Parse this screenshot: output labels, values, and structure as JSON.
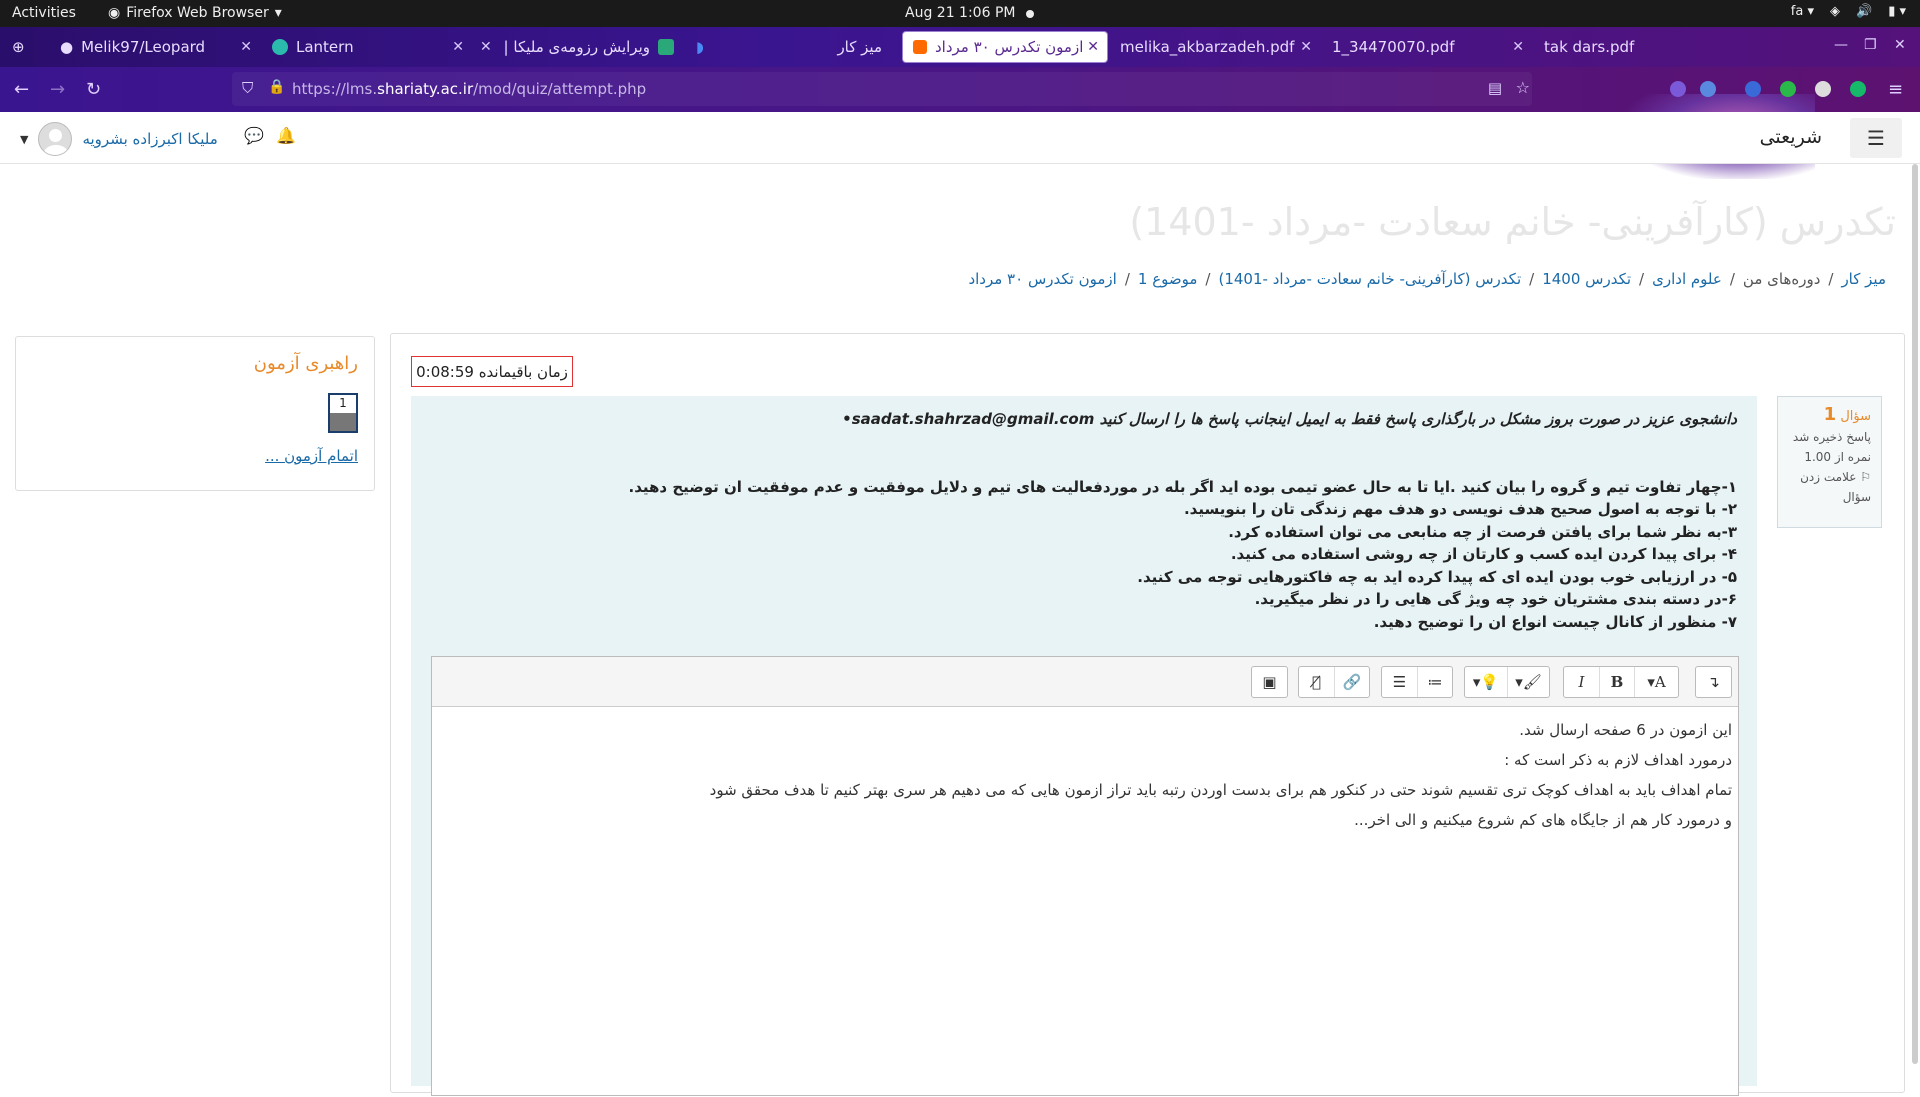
{
  "system": {
    "activities": "Activities",
    "app_name": "Firefox Web Browser",
    "clock": "Aug 21  1:06 PM",
    "lang": "fa"
  },
  "tabs": [
    {
      "label": "Melik97/Leopard",
      "active": false
    },
    {
      "label": "Lantern",
      "active": false
    },
    {
      "label": "ویرایش رزومه‌ی ملیکا |",
      "active": false
    },
    {
      "label": "میز کار",
      "active": false
    },
    {
      "label": "ازمون تکدرس ۳۰ مرداد",
      "active": true
    },
    {
      "label": "melika_akbarzadeh.pdf",
      "active": false
    },
    {
      "label": "1_34470070.pdf",
      "active": false
    },
    {
      "label": "tak dars.pdf",
      "active": false
    }
  ],
  "nav": {
    "url_prefix": "https://lms.",
    "url_host": "shariaty.ac.ir",
    "url_path": "/mod/quiz/attempt.php"
  },
  "header": {
    "site_name": "شریعتی",
    "user_name": "ملیکا اکبرزاده بشرویه"
  },
  "page": {
    "title": "تکدرس (کارآفرینی- خانم سعادت -مرداد -1401)",
    "breadcrumb": [
      {
        "label": "میز کار",
        "link": true
      },
      {
        "label": "دوره‌های من",
        "link": false
      },
      {
        "label": "علوم اداری",
        "link": true
      },
      {
        "label": "تکدرس 1400",
        "link": true
      },
      {
        "label": "تکدرس (کارآفرینی- خانم سعادت -مرداد -1401)",
        "link": true
      },
      {
        "label": "موضوع 1",
        "link": true
      },
      {
        "label": "ازمون تکدرس ۳۰ مرداد",
        "link": true
      }
    ]
  },
  "quiz_nav": {
    "title": "راهبری آزمون",
    "question_number": "1",
    "finish_link": "اتمام آزمون ..."
  },
  "timer": "زمان باقیمانده 0:08:59",
  "question": {
    "label": "سؤال",
    "number": "1",
    "state": "پاسخ ذخیره شد",
    "mark": "نمره از 1.00",
    "flag": "علامت زدن سؤال",
    "intro": "دانشجوی عزیز در صورت بروز مشکل در بارگذاری پاسخ فقط به ایمیل اینجانب پاسخ ها را ارسال کنید saadat.shahrzad@gmail.com•",
    "items": [
      "۱-چهار تفاوت  تیم و گروه را بیان کنید .ایا تا به حال  عضو تیمی بوده اید اگر بله در موردفعالیت های تیم و دلایل موفقیت و عدم موفقیت ان توضیح دهید.",
      "۲- با توجه به اصول صحیح هدف نویسی دو هدف مهم زندگی تان را بنویسید.",
      "۳-به نظر شما برای یافتن فرصت از چه منابعی می توان استفاده کرد.",
      "۴- برای پیدا کردن ایده کسب و کارتان از چه روشی استفاده می کنید.",
      "۵- در ارزیابی خوب بودن ایده ای که پیدا کرده اید به چه فاکتورهایی توجه می کنید.",
      "۶-در دسته بندی مشتریان خود چه ویژ گی هایی را در نظر میگیرید.",
      "۷- منظور از کانال چیست انواع ان را توضیح دهید."
    ]
  },
  "answer": {
    "lines": [
      "این ازمون در 6 صفحه ارسال شد.",
      "درمورد اهداف لازم به ذکر است که :",
      "تمام اهداف باید به اهداف کوچک تری تقسیم شوند حتی در کنکور هم برای بدست اوردن رتبه باید تراز ازمون هایی که می دهیم هر سری بهتر کنیم تا هدف محقق شود",
      "و درمورد کار هم از جایگاه های کم شروع میکنیم و الی اخر..."
    ]
  },
  "icons": {
    "colors": {
      "accent": "#1a6aa8",
      "orange": "#e88a2a",
      "qbg": "#e7f3f5",
      "timer_border": "#dd3333"
    }
  }
}
